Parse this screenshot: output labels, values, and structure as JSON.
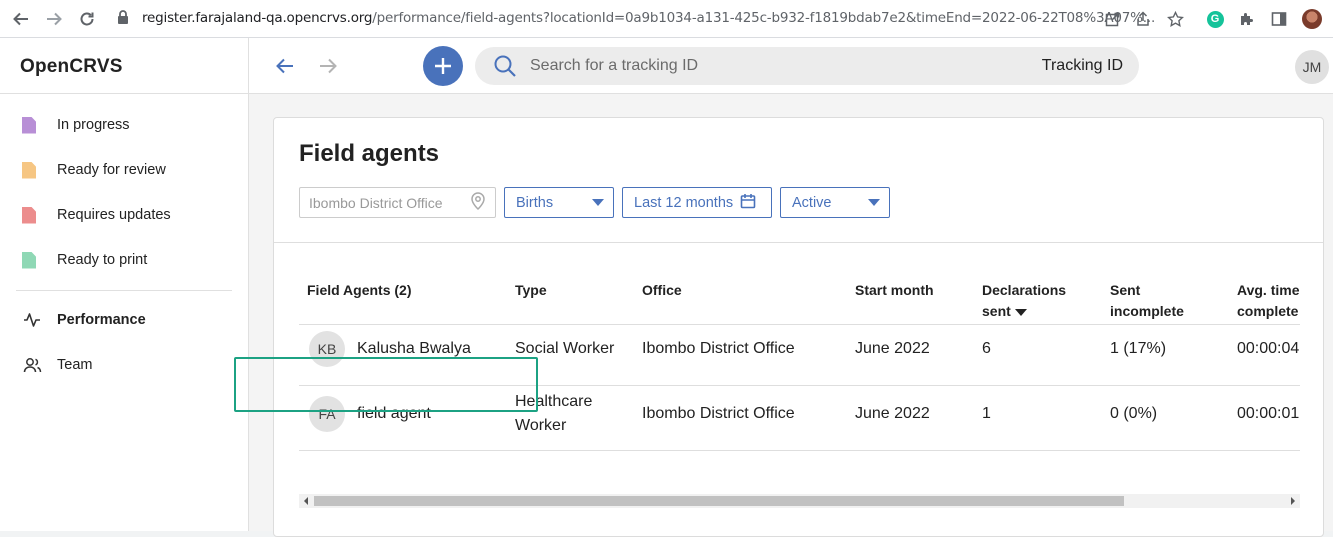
{
  "browser": {
    "url_host": "register.farajaland-qa.opencrvs.org",
    "url_rest": "/performance/field-agents?locationId=0a9b1034-a131-425c-b932-f1819bdab7e2&timeEnd=2022-06-22T08%3A07%..."
  },
  "app": {
    "brand": "OpenCRVS",
    "user_initials": "JM"
  },
  "sidebar": {
    "items": [
      {
        "label": "In progress",
        "icon": "document-icon",
        "color": "#b88fd6"
      },
      {
        "label": "Ready for review",
        "icon": "document-icon",
        "color": "#f6c683"
      },
      {
        "label": "Requires updates",
        "icon": "document-icon",
        "color": "#ec8d8d"
      },
      {
        "label": "Ready to print",
        "icon": "document-icon",
        "color": "#8fd8b5"
      }
    ],
    "nav": [
      {
        "label": "Performance",
        "icon": "activity-icon"
      },
      {
        "label": "Team",
        "icon": "users-icon"
      }
    ]
  },
  "search": {
    "placeholder": "Search for a tracking ID",
    "type_label": "Tracking ID"
  },
  "page": {
    "title": "Field agents",
    "filters": {
      "location": "Ibombo District Office",
      "event": "Births",
      "period": "Last 12 months",
      "status": "Active"
    }
  },
  "table": {
    "headers": {
      "agent": "Field Agents (2)",
      "type": "Type",
      "office": "Office",
      "start_month": "Start month",
      "declarations_1": "Declarations",
      "declarations_2": "sent",
      "incomplete_1": "Sent",
      "incomplete_2": "incomplete",
      "avg_1": "Avg. time",
      "avg_2": "complete"
    },
    "rows": [
      {
        "initials": "KB",
        "name": "Kalusha Bwalya",
        "type_1": "Social Worker",
        "type_2": "",
        "office": "Ibombo District Office",
        "start_month": "June 2022",
        "declarations": "6",
        "incomplete": "1 (17%)",
        "avg_time": "00:00:04"
      },
      {
        "initials": "FA",
        "name": "field agent",
        "type_1": "Healthcare",
        "type_2": "Worker",
        "office": "Ibombo District Office",
        "start_month": "June 2022",
        "declarations": "1",
        "incomplete": "0 (0%)",
        "avg_time": "00:00:01"
      }
    ]
  },
  "colors": {
    "primary": "#4972bb",
    "highlight": "#1ca283"
  }
}
